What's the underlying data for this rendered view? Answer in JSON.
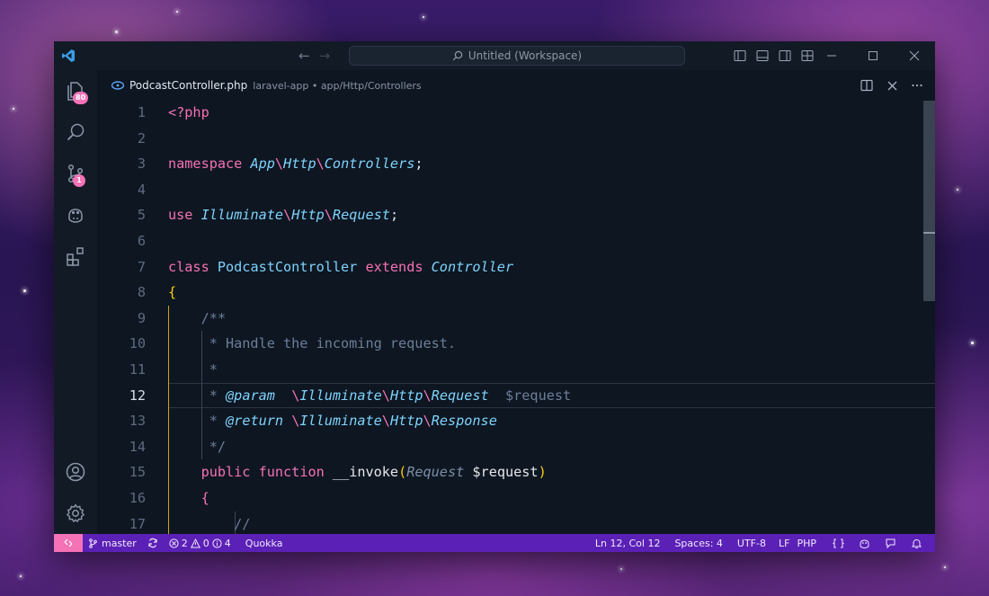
{
  "window": {
    "command_center": "Untitled (Workspace)"
  },
  "activity_bar": {
    "explorer_badge": "80",
    "source_control_badge": "1"
  },
  "tab": {
    "file_name": "PodcastController.php",
    "path": "laravel-app • app/Http/Controllers"
  },
  "editor": {
    "current_line": 12,
    "lines": [
      {
        "n": "1"
      },
      {
        "n": "2"
      },
      {
        "n": "3"
      },
      {
        "n": "4"
      },
      {
        "n": "5"
      },
      {
        "n": "6"
      },
      {
        "n": "7"
      },
      {
        "n": "8"
      },
      {
        "n": "9"
      },
      {
        "n": "10"
      },
      {
        "n": "11"
      },
      {
        "n": "12"
      },
      {
        "n": "13"
      },
      {
        "n": "14"
      },
      {
        "n": "15"
      },
      {
        "n": "16"
      },
      {
        "n": "17"
      }
    ],
    "tokens": {
      "l1": "<?php",
      "l3_kw": "namespace",
      "l3_a": "App",
      "l3_b": "Http",
      "l3_c": "Controllers",
      "l5_kw": "use",
      "l5_a": "Illuminate",
      "l5_b": "Http",
      "l5_c": "Request",
      "l7_kw1": "class",
      "l7_name": "PodcastController",
      "l7_kw2": "extends",
      "l7_base": "Controller",
      "l8": "{",
      "l9": "/**",
      "l10": "* Handle the incoming request.",
      "l11": "*",
      "l12_star": "*",
      "l12_tag": "@param",
      "l12_a": "Illuminate",
      "l12_b": "Http",
      "l12_c": "Request",
      "l12_var": "$request",
      "l13_star": "*",
      "l13_tag": "@return",
      "l13_a": "Illuminate",
      "l13_b": "Http",
      "l13_c": "Response",
      "l14": "*/",
      "l15_kw1": "public",
      "l15_kw2": "function",
      "l15_fn": "__invoke",
      "l15_type": "Request",
      "l15_var": "$request",
      "l16": "{",
      "l17": "//"
    }
  },
  "statusbar": {
    "branch": "master",
    "errors": "2",
    "warnings": "0",
    "info": "4",
    "quokka": "Quokka",
    "position": "Ln 12, Col 12",
    "spaces": "Spaces: 4",
    "encoding": "UTF-8",
    "eol": "LF",
    "language": "PHP"
  },
  "colors": {
    "accent_pink": "#f472b6",
    "statusbar_purple": "#5b21b6",
    "keyword": "#f472b6",
    "type": "#7dd3fc",
    "comment": "#6b7f99"
  }
}
